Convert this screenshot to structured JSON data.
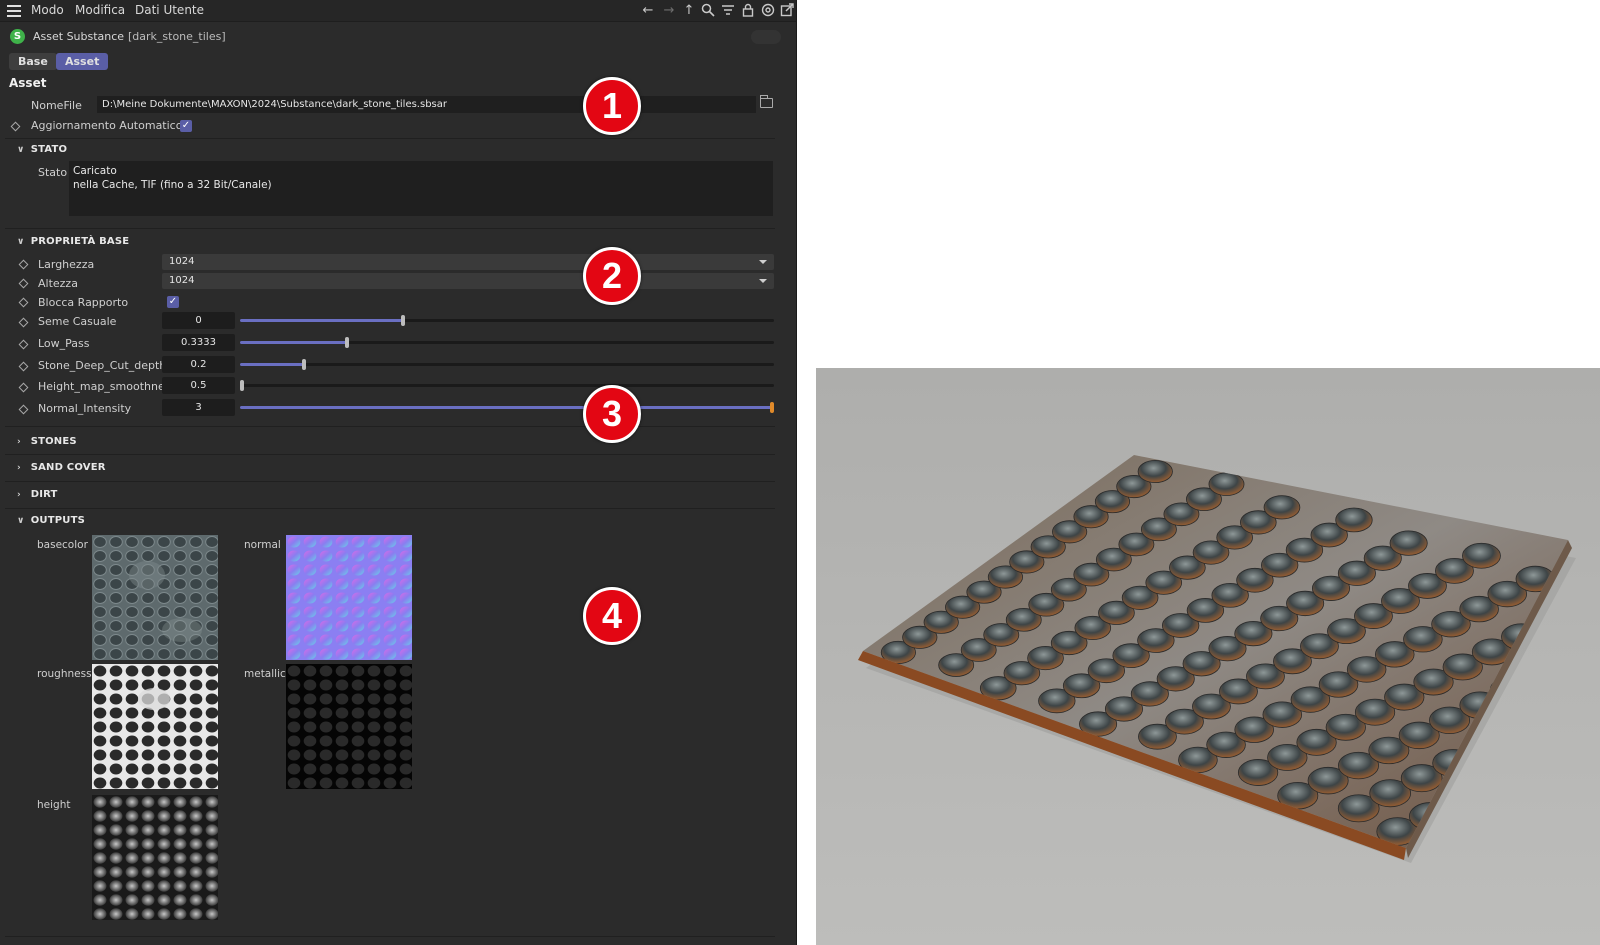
{
  "menubar": {
    "items": [
      "Modo",
      "Modifica",
      "Dati Utente"
    ],
    "tools": [
      "back-arrow-icon",
      "forward-arrow-icon",
      "up-arrow-icon",
      "search-icon",
      "filter-icon",
      "lock-icon",
      "target-icon",
      "new-window-icon"
    ]
  },
  "object": {
    "type_name": "Asset Substance",
    "instance_name": "[dark_stone_tiles]"
  },
  "tabs": [
    {
      "label": "Base",
      "active": false
    },
    {
      "label": "Asset",
      "active": true
    }
  ],
  "asset": {
    "section_title": "Asset",
    "filename_label": "NomeFile",
    "filename_value": "D:\\Meine Dokumente\\MAXON\\2024\\Substance\\dark_stone_tiles.sbsar",
    "auto_update_label": "Aggiornamento Automatico",
    "auto_update_checked": true
  },
  "stato": {
    "group_label": "STATO",
    "label": "Stato",
    "line1": "Caricato",
    "line2": "nella Cache, TIF (fino a 32 Bit/Canale)"
  },
  "base_props": {
    "group_label": "PROPRIETÀ BASE",
    "width_label": "Larghezza",
    "width_value": "1024",
    "height_label": "Altezza",
    "height_value": "1024",
    "lock_label": "Blocca Rapporto",
    "lock_checked": true,
    "sliders": [
      {
        "label": "Seme Casuale",
        "value": "0",
        "fraction": 0.305
      },
      {
        "label": "Low_Pass",
        "value": "0.3333",
        "fraction": 0.2
      },
      {
        "label": "Stone_Deep_Cut_depth",
        "value": "0.2",
        "fraction": 0.12
      },
      {
        "label": "Height_map_smoothness",
        "value": "0.5",
        "fraction": 0.0
      },
      {
        "label": "Normal_Intensity",
        "value": "3",
        "fraction": 1.0
      }
    ]
  },
  "groups": {
    "stones": "STONES",
    "sand_cover": "SAND COVER",
    "dirt": "DIRT",
    "outputs": "OUTPUTS"
  },
  "outputs": {
    "basecolor": "basecolor",
    "normal": "normal",
    "roughness": "roughness",
    "metallic": "metallic",
    "height": "height"
  },
  "callouts": [
    "1",
    "2",
    "3",
    "4"
  ],
  "colors": {
    "panel_bg": "#2b2b2b",
    "accent": "#5a5ea6",
    "slider_fill": "#6a6fc2",
    "callout_red": "#e30613",
    "render_bg": "#b5b5b3"
  }
}
